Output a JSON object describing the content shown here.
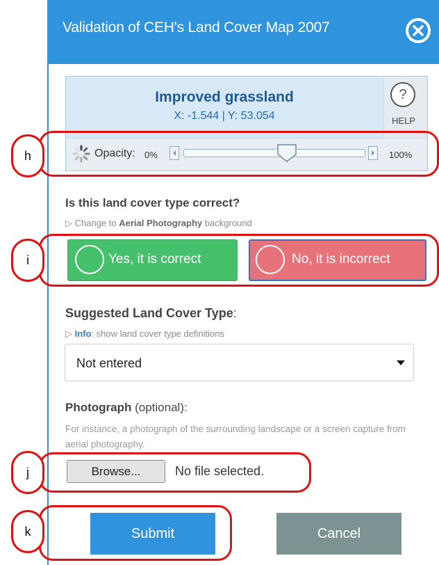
{
  "dialog": {
    "title": "Validation of CEH's Land Cover Map 2007",
    "close_icon": "close-icon"
  },
  "info": {
    "cover_name": "Improved grassland",
    "coords": "X: -1.544 | Y: 53.054",
    "help_label": "HELP",
    "help_symbol": "?"
  },
  "opacity": {
    "label": "Opacity:",
    "min": "0%",
    "max": "100%",
    "value_percent": 57
  },
  "question": {
    "text": "Is this land cover type correct?",
    "aerial_prefix": "▷ Change to ",
    "aerial_bold": "Aerial Photography",
    "aerial_suffix": " background",
    "yes_label": "Yes, it is correct",
    "no_label": "No, it is incorrect"
  },
  "suggested": {
    "title_bold": "Suggested Land Cover Type",
    "title_suffix": ":",
    "info_prefix": "▷ ",
    "info_bold": "Info",
    "info_suffix": ": show land cover type definitions",
    "selected_value": "Not entered"
  },
  "photograph": {
    "title_bold": "Photograph",
    "title_suffix": " (optional):",
    "description": "For instance, a photograph of the surrounding landscape or a screen capture from aerial photography.",
    "browse_label": "Browse...",
    "file_status": "No file selected."
  },
  "actions": {
    "submit_label": "Submit",
    "cancel_label": "Cancel"
  },
  "annotations": {
    "h": "h",
    "i": "i",
    "j": "j",
    "k": "k"
  },
  "colors": {
    "header_blue": "#2f93dd",
    "yes_green": "#47c06c",
    "no_red": "#e8727a",
    "cancel_gray": "#7c9293",
    "annotation_red": "#e01010"
  }
}
